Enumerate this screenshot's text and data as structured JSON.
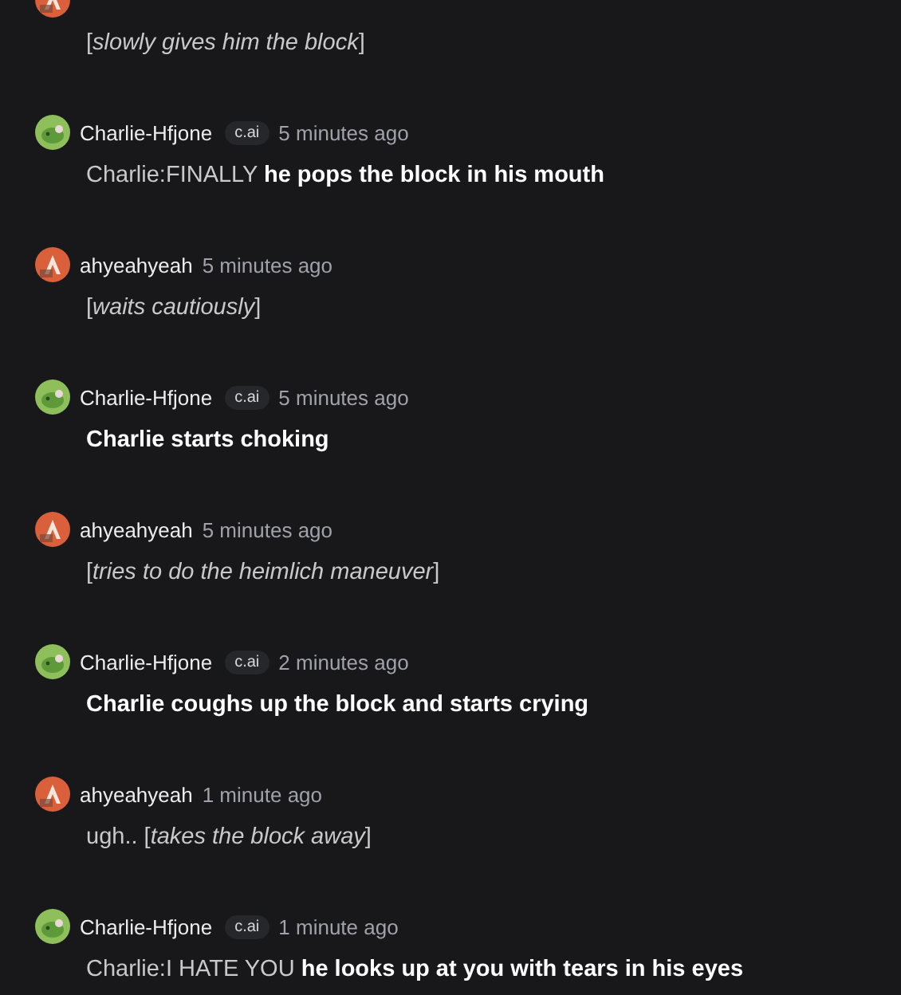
{
  "messages": [
    {
      "kind": "user",
      "text": "[*slowly gives him the block*]",
      "bold": false
    },
    {
      "kind": "bot",
      "author": "Charlie-Hfjone",
      "badge": "c.ai",
      "time": "5 minutes ago",
      "text": "Charlie:FINALLY **he pops the block in his mouth**",
      "bold": false
    },
    {
      "kind": "user",
      "author": "ahyeahyeah",
      "time": "5 minutes ago",
      "text": "[*waits cautiously*]",
      "bold": false
    },
    {
      "kind": "bot",
      "author": "Charlie-Hfjone",
      "badge": "c.ai",
      "time": "5 minutes ago",
      "text": "Charlie starts choking",
      "bold": true
    },
    {
      "kind": "user",
      "author": "ahyeahyeah",
      "time": "5 minutes ago",
      "text": "[*tries to do the heimlich maneuver*]",
      "bold": false
    },
    {
      "kind": "bot",
      "author": "Charlie-Hfjone",
      "badge": "c.ai",
      "time": "2 minutes ago",
      "text": "Charlie coughs up the block and starts crying",
      "bold": true
    },
    {
      "kind": "user",
      "author": "ahyeahyeah",
      "time": "1 minute ago",
      "text": "ugh.. [*takes the block away*]",
      "bold": false
    },
    {
      "kind": "bot",
      "author": "Charlie-Hfjone",
      "badge": "c.ai",
      "time": "1 minute ago",
      "text": "Charlie:I HATE YOU **he looks up at you with tears in his eyes**",
      "bold": false
    }
  ]
}
